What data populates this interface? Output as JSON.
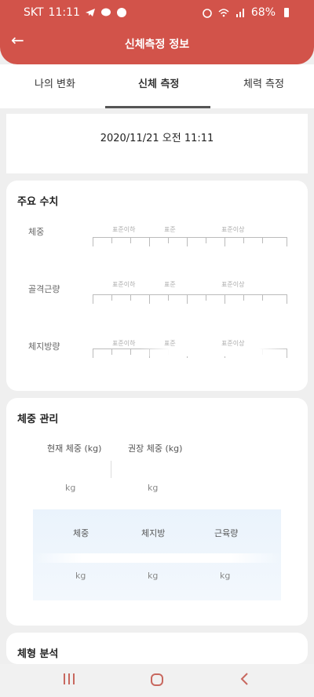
{
  "status_bar": {
    "carrier": "SKT",
    "time": "11:11",
    "battery": "68%"
  },
  "header": {
    "title": "신체측정 정보"
  },
  "tabs": [
    {
      "label": "나의 변화"
    },
    {
      "label": "신체 측정"
    },
    {
      "label": "체력 측정"
    }
  ],
  "measurement": {
    "datetime": "2020/11/21 오전 11:11"
  },
  "main_values": {
    "title": "주요 수치",
    "scale": {
      "low": "표준이하",
      "normal": "표준",
      "high": "표준이상"
    },
    "metrics": [
      {
        "label": "체중"
      },
      {
        "label": "골격근량"
      },
      {
        "label": "체지방량"
      }
    ]
  },
  "weight_management": {
    "title": "체중 관리",
    "current_label": "현재 체중 (kg)",
    "recommended_label": "권장 체중 (kg)",
    "unit": "kg",
    "breakdown": [
      {
        "label": "체중"
      },
      {
        "label": "체지방"
      },
      {
        "label": "근육량"
      }
    ]
  },
  "body_type": {
    "title": "체형 분석"
  },
  "colors": {
    "accent": "#d2534a",
    "nav_icon": "#c8685f"
  }
}
